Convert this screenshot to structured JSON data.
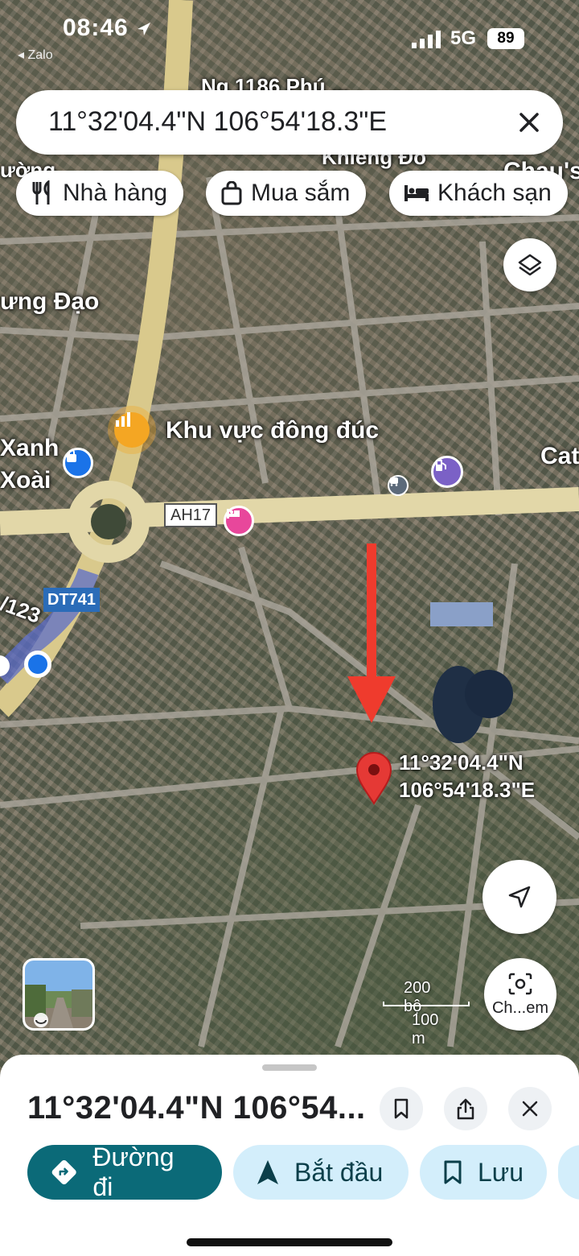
{
  "status_bar": {
    "time": "08:46",
    "back_app": "◂ Zalo",
    "network": "5G",
    "battery": "89"
  },
  "search": {
    "query": "11°32'04.4\"N 106°54'18.3\"E"
  },
  "chips": [
    {
      "label": "Nhà hàng",
      "icon": "restaurant-icon"
    },
    {
      "label": "Mua sắm",
      "icon": "shopping-bag-icon"
    },
    {
      "label": "Khách sạn",
      "icon": "hotel-bed-icon"
    }
  ],
  "map": {
    "labels": {
      "road_top": "Ng 1186 Phú ...",
      "street_top2": "Khiêng Đỏ",
      "chau": "Chau's",
      "hung_dao": "ưng Đạo",
      "crowded_area": "Khu vực đông đúc",
      "xanh": "Xanh",
      "xoai": "Xoài",
      "cat": "Cat",
      "duong_left": "ường"
    },
    "route_badges": {
      "ah17": "AH17",
      "dt741": "DT741",
      "r123": "/123"
    },
    "pin": {
      "lat": "11°32'04.4\"N",
      "lng": "106°54'18.3\"E"
    },
    "scale": {
      "feet": "200 bộ",
      "meters": "100 m"
    },
    "lens_button": "Ch...em"
  },
  "sheet": {
    "title": "11°32'04.4\"N 106°54...",
    "actions": {
      "directions": "Đường đi",
      "start": "Bắt đầu",
      "save": "Lưu"
    }
  },
  "colors": {
    "accent_teal": "#0b6a78",
    "chip_blue": "#d3eefb",
    "pin_red": "#e53935",
    "arrow_red": "#ef3b2d",
    "road_yellow": "#e8d9a0"
  }
}
